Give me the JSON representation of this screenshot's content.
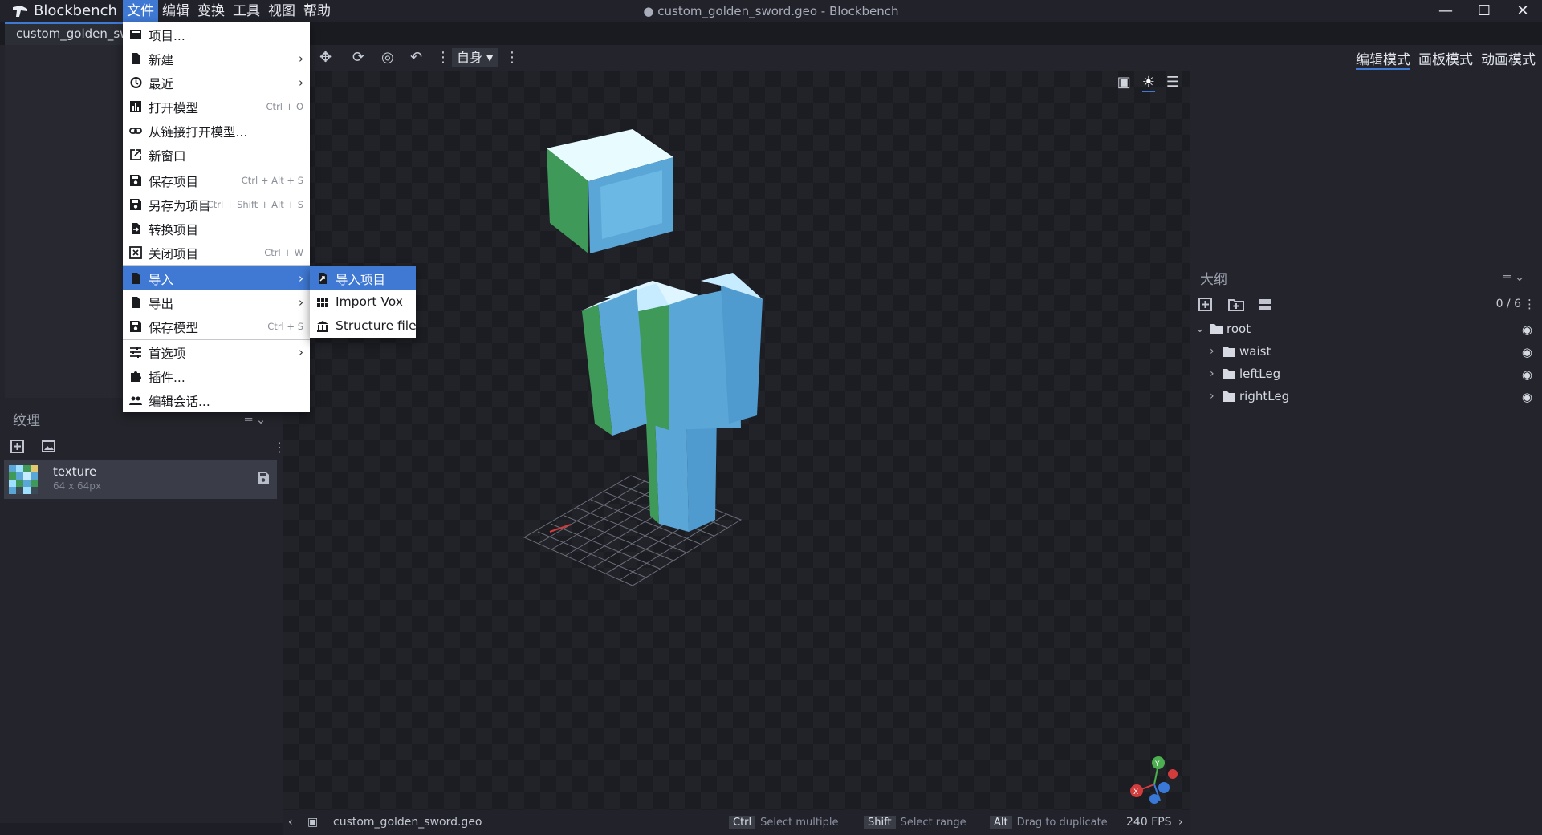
{
  "app": {
    "name": "Blockbench",
    "window_title": "● custom_golden_sword.geo - Blockbench",
    "menubar": [
      "文件",
      "编辑",
      "变换",
      "工具",
      "视图",
      "帮助"
    ],
    "window_controls": [
      "—",
      "☐",
      "✕"
    ]
  },
  "tabs": [
    "custom_golden_sword"
  ],
  "file_menu": {
    "items": [
      {
        "label": "项目...",
        "shortcut": "",
        "submenu": false,
        "icon": "project-icon"
      },
      {
        "label": "新建",
        "shortcut": "",
        "submenu": true,
        "icon": "file-icon"
      },
      {
        "label": "最近",
        "shortcut": "",
        "submenu": true,
        "icon": "history-icon"
      },
      {
        "label": "打开模型",
        "shortcut": "Ctrl + O",
        "submenu": false,
        "icon": "chart-icon"
      },
      {
        "label": "从链接打开模型...",
        "shortcut": "",
        "submenu": false,
        "icon": "link-icon"
      },
      {
        "label": "新窗口",
        "shortcut": "",
        "submenu": false,
        "icon": "open-in-new-icon"
      },
      {
        "label": "保存项目",
        "shortcut": "Ctrl + Alt + S",
        "submenu": false,
        "icon": "save-icon"
      },
      {
        "label": "另存为项目",
        "shortcut": "Ctrl + Shift + Alt + S",
        "submenu": false,
        "icon": "save-icon"
      },
      {
        "label": "转换项目",
        "shortcut": "",
        "submenu": false,
        "icon": "convert-icon"
      },
      {
        "label": "关闭项目",
        "shortcut": "Ctrl + W",
        "submenu": false,
        "icon": "close-box-icon"
      },
      {
        "label": "导入",
        "shortcut": "",
        "submenu": true,
        "icon": "file-icon"
      },
      {
        "label": "导出",
        "shortcut": "",
        "submenu": true,
        "icon": "file-icon"
      },
      {
        "label": "保存模型",
        "shortcut": "Ctrl + S",
        "submenu": false,
        "icon": "save-icon"
      },
      {
        "label": "首选项",
        "shortcut": "",
        "submenu": true,
        "icon": "tune-icon"
      },
      {
        "label": "插件...",
        "shortcut": "",
        "submenu": false,
        "icon": "puzzle-icon"
      },
      {
        "label": "编辑会话...",
        "shortcut": "",
        "submenu": false,
        "icon": "people-icon"
      }
    ]
  },
  "import_submenu": {
    "items": [
      {
        "label": "导入项目",
        "icon": "import-file-icon"
      },
      {
        "label": "Import Vox",
        "icon": "grid-icon"
      },
      {
        "label": "Structure file",
        "icon": "bank-icon"
      }
    ]
  },
  "toolbar": {
    "transform_space": "自身"
  },
  "viewport": {
    "icons": [
      "image-icon",
      "brightness-icon",
      "menu-icon"
    ]
  },
  "modes": [
    "编辑模式",
    "画板模式",
    "动画模式"
  ],
  "textures_panel": {
    "title": "纹理",
    "texture": {
      "name": "texture",
      "size": "64 x 64px"
    }
  },
  "outliner": {
    "title": "大纲",
    "count": "0 / 6",
    "nodes": [
      {
        "name": "root",
        "level": 0,
        "expanded": true
      },
      {
        "name": "waist",
        "level": 1,
        "expanded": false
      },
      {
        "name": "leftLeg",
        "level": 1,
        "expanded": false
      },
      {
        "name": "rightLeg",
        "level": 1,
        "expanded": false
      }
    ]
  },
  "statusbar": {
    "file": "custom_golden_sword.geo",
    "hints": [
      {
        "key": "Ctrl",
        "text": "Select multiple"
      },
      {
        "key": "Shift",
        "text": "Select range"
      },
      {
        "key": "Alt",
        "text": "Drag to duplicate"
      }
    ],
    "fps": "240 FPS"
  },
  "colors": {
    "accent": "#3f79d4",
    "model_blue": "#5aa6d6",
    "model_green": "#3f9a5a",
    "menu_bg": "#ffffff"
  }
}
